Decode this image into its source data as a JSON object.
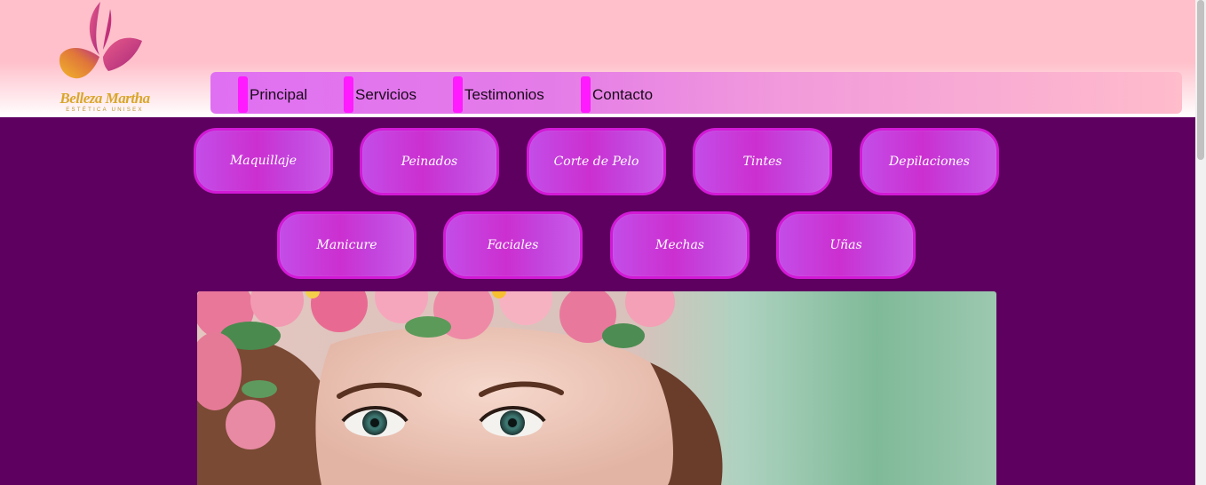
{
  "brand": {
    "name": "Belleza Martha",
    "tagline": "ESTÉTICA UNISEX",
    "logo_icon": "butterfly-logo-icon"
  },
  "nav": {
    "items": [
      {
        "label": "Principal"
      },
      {
        "label": "Servicios"
      },
      {
        "label": "Testimonios"
      },
      {
        "label": "Contacto"
      }
    ]
  },
  "services": {
    "row1": [
      {
        "label": "Maquillaje"
      },
      {
        "label": "Peinados"
      },
      {
        "label": "Corte de Pelo"
      },
      {
        "label": "Tintes"
      },
      {
        "label": "Depilaciones"
      }
    ],
    "row2": [
      {
        "label": "Manicure"
      },
      {
        "label": "Faciales"
      },
      {
        "label": "Mechas"
      },
      {
        "label": "Uñas"
      }
    ]
  },
  "hero": {
    "image": "woman-with-flower-crown-photo"
  },
  "colors": {
    "page_background": "#5e0060",
    "header_pink": "#ffc0cb",
    "nav_marker": "#ff1aff",
    "button_border": "#d21ad6",
    "logo_gold": "#d9a62a"
  }
}
